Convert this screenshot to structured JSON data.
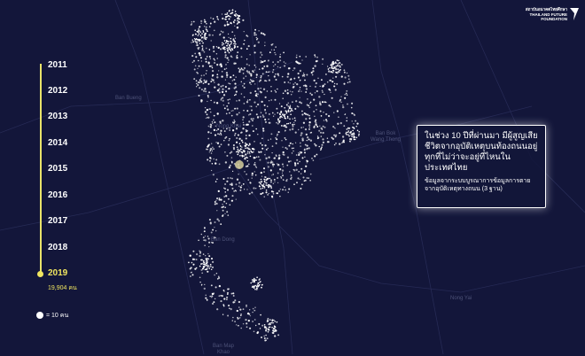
{
  "timeline": {
    "years": [
      "2011",
      "2012",
      "2013",
      "2014",
      "2015",
      "2016",
      "2017",
      "2018",
      "2019"
    ],
    "selected_year": "2019",
    "selected_count": "19,904 คน"
  },
  "legend": {
    "label": "= 10 คน"
  },
  "info_card": {
    "title": "ในช่วง 10 ปีที่ผ่านมา มีผู้สูญเสียชีวิตจากอุบัติเหตุบนท้องถนนอยู่ทุกที่ไม่ว่าจะอยู่ที่ไหนในประเทศไทย",
    "subtitle": "ข้อมูลจากระบบบูรณาการข้อมูลการตายจากอุบัติเหตุทางถนน (3 ฐาน)"
  },
  "logo": {
    "line1": "สถาบันอนาคตไทยศึกษา",
    "line2": "THAILAND FUTURE",
    "line3": "FOUNDATION"
  },
  "places": {
    "ban_bueng": "Ban Bueng",
    "nong_khai": "Nong Khai",
    "ban_bok_wang_thong": "Ban Bok\nWang Thong",
    "ban_dong": "Ban Dong",
    "nong_yai": "Nong Yai",
    "ban_map": "Ban Map\nKhao"
  },
  "colors": {
    "background": "#13163a",
    "accent": "#f1e660",
    "dots": "#ffffff"
  }
}
